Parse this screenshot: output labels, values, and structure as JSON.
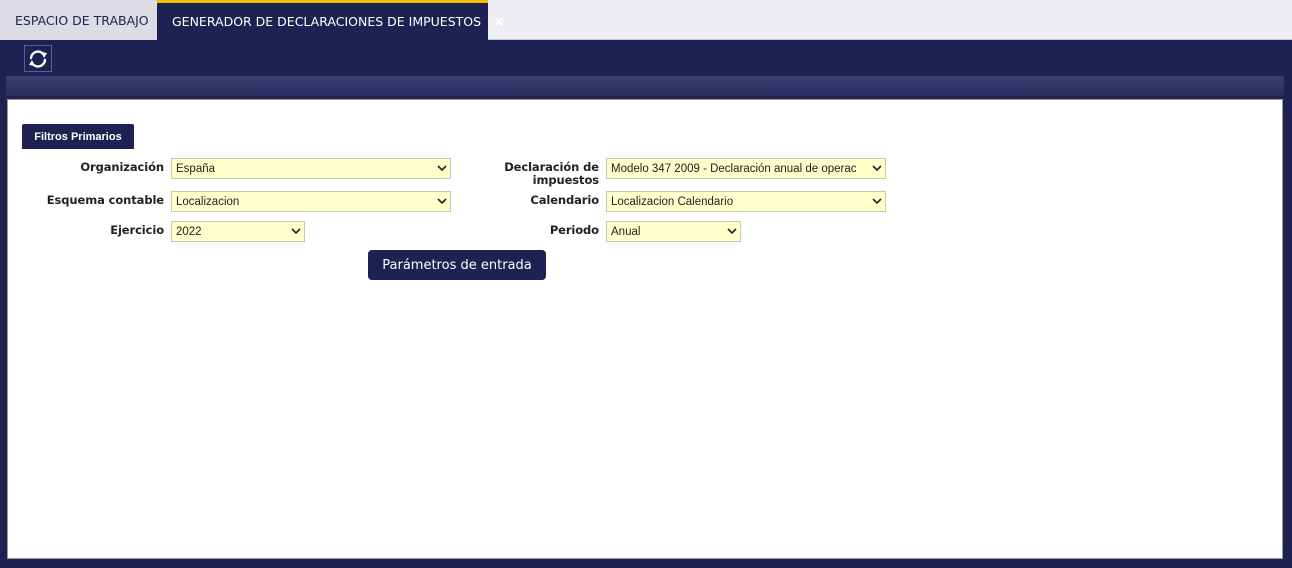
{
  "tabs": {
    "workspace_label": "ESPACIO DE TRABAJO",
    "active_label": "GENERADOR DE DECLARACIONES DE IMPUESTOS",
    "close_symbol": "×"
  },
  "toolbar": {
    "refresh_icon": "refresh-icon"
  },
  "section": {
    "title": "Filtros Primarios"
  },
  "filters": {
    "organizacion": {
      "label": "Organización",
      "value": "España"
    },
    "esquema": {
      "label": "Esquema contable",
      "value": "Localizacion"
    },
    "ejercicio": {
      "label": "Ejercicio",
      "value": "2022"
    },
    "declaracion": {
      "label_line1": "Declaración de",
      "label_line2": "impuestos",
      "value": "Modelo 347 2009 - Declaración anual de operac"
    },
    "calendario": {
      "label": "Calendario",
      "value": "Localizacion Calendario"
    },
    "periodo": {
      "label": "Periodo",
      "value": "Anual"
    }
  },
  "actions": {
    "input_params_label": "Parámetros de entrada"
  },
  "colors": {
    "brand_navy": "#1e2152",
    "active_tab_accent": "#f0c000",
    "field_background": "#ffffcc"
  }
}
